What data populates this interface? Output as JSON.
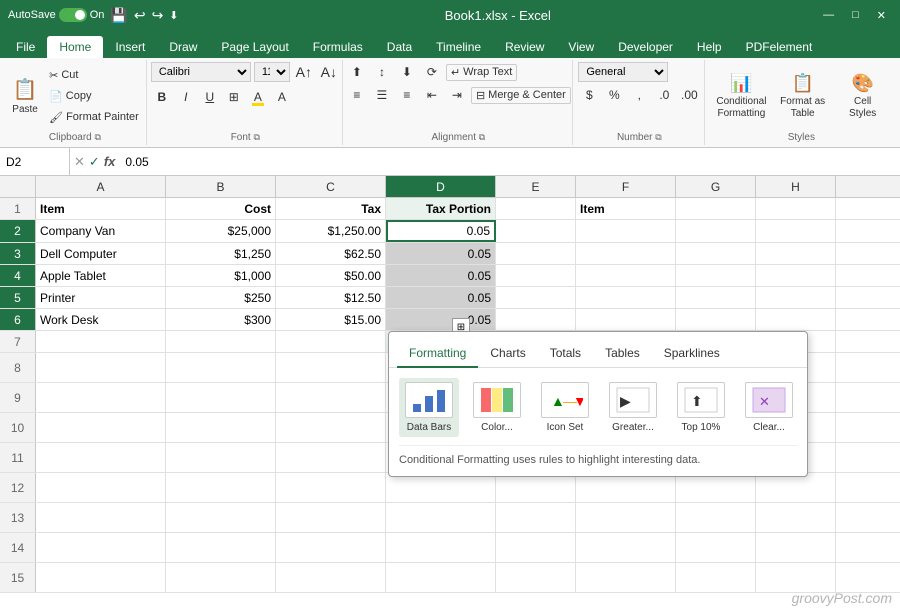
{
  "titleBar": {
    "autosave": "AutoSave",
    "toggleState": "On",
    "filename": "Book1.xlsx - Excel",
    "windowControls": [
      "—",
      "□",
      "✕"
    ]
  },
  "ribbonTabs": {
    "tabs": [
      "File",
      "Home",
      "Insert",
      "Draw",
      "Page Layout",
      "Formulas",
      "Data",
      "Timeline",
      "Review",
      "View",
      "Developer",
      "Help",
      "PDFelement"
    ],
    "activeTab": "Home"
  },
  "ribbon": {
    "groups": [
      {
        "name": "Clipboard",
        "label": "Clipboard"
      },
      {
        "name": "Font",
        "label": "Font"
      },
      {
        "name": "Alignment",
        "label": "Alignment"
      },
      {
        "name": "Number",
        "label": "Number"
      },
      {
        "name": "Styles",
        "label": "Styles"
      }
    ],
    "font": {
      "name": "Calibri",
      "size": "11",
      "bold": "B",
      "italic": "I",
      "underline": "U"
    },
    "wrapText": "Wrap Text",
    "mergeCenter": "Merge & Center",
    "numberFormat": "General",
    "conditionalFormatting": "Conditional Formatting",
    "formatAsTable": "Format as Table",
    "cellStyles": "Cell Styles"
  },
  "formulaBar": {
    "nameBox": "D2",
    "cancelBtn": "✕",
    "confirmBtn": "✓",
    "functionBtn": "fx",
    "formula": "0.05"
  },
  "columns": {
    "headers": [
      "A",
      "B",
      "C",
      "D",
      "E",
      "F",
      "G",
      "H"
    ],
    "widths": [
      130,
      110,
      110,
      110,
      80,
      100,
      80,
      80
    ]
  },
  "rows": [
    {
      "num": 1,
      "cells": [
        "Item",
        "Cost",
        "Tax",
        "Tax Portion",
        "",
        "Item",
        "",
        ""
      ]
    },
    {
      "num": 2,
      "cells": [
        "Company Van",
        "$25,000",
        "$1,250.00",
        "0.05",
        "",
        "",
        "",
        ""
      ]
    },
    {
      "num": 3,
      "cells": [
        "Dell Computer",
        "$1,250",
        "$62.50",
        "0.05",
        "",
        "",
        "",
        ""
      ]
    },
    {
      "num": 4,
      "cells": [
        "Apple Tablet",
        "$1,000",
        "$50.00",
        "0.05",
        "",
        "",
        "",
        ""
      ]
    },
    {
      "num": 5,
      "cells": [
        "Printer",
        "$250",
        "$12.50",
        "0.05",
        "",
        "",
        "",
        ""
      ]
    },
    {
      "num": 6,
      "cells": [
        "Work Desk",
        "$300",
        "$15.00",
        "0.05",
        "",
        "",
        "",
        ""
      ]
    },
    {
      "num": 7,
      "cells": [
        "",
        "",
        "",
        "",
        "",
        "",
        "",
        ""
      ]
    },
    {
      "num": 8,
      "cells": [
        "",
        "",
        "",
        "",
        "",
        "",
        "",
        ""
      ]
    },
    {
      "num": 9,
      "cells": [
        "",
        "",
        "",
        "",
        "",
        "",
        "",
        ""
      ]
    },
    {
      "num": 10,
      "cells": [
        "",
        "",
        "",
        "",
        "",
        "",
        "",
        ""
      ]
    },
    {
      "num": 11,
      "cells": [
        "",
        "",
        "",
        "",
        "",
        "",
        "",
        ""
      ]
    },
    {
      "num": 12,
      "cells": [
        "",
        "",
        "",
        "",
        "",
        "",
        "",
        ""
      ]
    },
    {
      "num": 13,
      "cells": [
        "",
        "",
        "",
        "",
        "",
        "",
        "",
        ""
      ]
    },
    {
      "num": 14,
      "cells": [
        "",
        "",
        "",
        "",
        "",
        "",
        "",
        ""
      ]
    },
    {
      "num": 15,
      "cells": [
        "",
        "",
        "",
        "",
        "",
        "",
        "",
        ""
      ]
    }
  ],
  "quickAnalysis": {
    "tabs": [
      "Formatting",
      "Charts",
      "Totals",
      "Tables",
      "Sparklines"
    ],
    "activeTab": "Formatting",
    "items": [
      {
        "icon": "▦",
        "label": "Data Bars"
      },
      {
        "icon": "◨",
        "label": "Color..."
      },
      {
        "icon": "★",
        "label": "Icon Set"
      },
      {
        "icon": "▶",
        "label": "Greater..."
      },
      {
        "icon": "⬆",
        "label": "Top 10%"
      },
      {
        "icon": "✕",
        "label": "Clear..."
      }
    ],
    "description": "Conditional Formatting uses rules to highlight interesting data."
  },
  "watermark": "groovyPost.com"
}
